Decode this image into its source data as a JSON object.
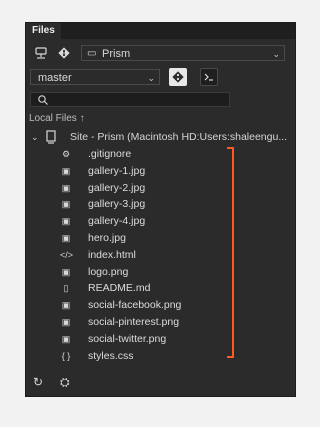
{
  "panel": {
    "tab_label": "Files"
  },
  "toolbar": {
    "site_dropdown_value": "Prism",
    "branch_value": "master"
  },
  "search": {
    "placeholder": ""
  },
  "section": {
    "label": "Local Files",
    "sort_glyph": "↑"
  },
  "site": {
    "label": "Site - Prism (Macintosh HD:Users:shaleengu..."
  },
  "files": [
    {
      "name": ".gitignore",
      "icon": "settings-file-icon"
    },
    {
      "name": "gallery-1.jpg",
      "icon": "image-file-icon"
    },
    {
      "name": "gallery-2.jpg",
      "icon": "image-file-icon"
    },
    {
      "name": "gallery-3.jpg",
      "icon": "image-file-icon"
    },
    {
      "name": "gallery-4.jpg",
      "icon": "image-file-icon"
    },
    {
      "name": "hero.jpg",
      "icon": "image-file-icon"
    },
    {
      "name": "index.html",
      "icon": "code-file-icon"
    },
    {
      "name": "logo.png",
      "icon": "image-file-icon"
    },
    {
      "name": "README.md",
      "icon": "text-file-icon"
    },
    {
      "name": "social-facebook.png",
      "icon": "image-file-icon"
    },
    {
      "name": "social-pinterest.png",
      "icon": "image-file-icon"
    },
    {
      "name": "social-twitter.png",
      "icon": "image-file-icon"
    },
    {
      "name": "styles.css",
      "icon": "css-file-icon"
    }
  ],
  "colors": {
    "panel_bg": "#2b2b2b",
    "accent_bracket": "#ff5a1f"
  }
}
